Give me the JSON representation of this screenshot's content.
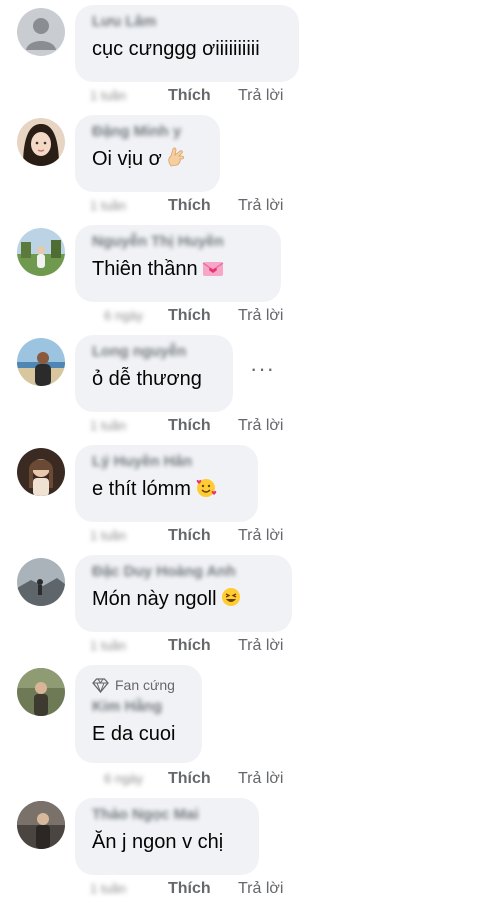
{
  "comments": [
    {
      "author": "Lưu Lâm",
      "text": "cục cưnggg ơiiiiiiiiii",
      "emoji": "",
      "time": "1 tuần",
      "like": "Thích",
      "reply": "Trả lời"
    },
    {
      "author": "Đặng Minh y",
      "text": "Oi vịu ơ",
      "emoji": "hand-emoji",
      "time": "1 tuần",
      "like": "Thích",
      "reply": "Trả lời"
    },
    {
      "author": "Nguyễn Thị Huyền",
      "text": "Thiên thầnn",
      "emoji": "love-letter-emoji",
      "time": "6 ngày",
      "like": "Thích",
      "reply": "Trả lời"
    },
    {
      "author": "Long nguyễn",
      "text": "ỏ dễ thương",
      "emoji": "",
      "time": "1 tuần",
      "like": "Thích",
      "reply": "Trả lời",
      "more": "···"
    },
    {
      "author": "Lý Huyền Hân",
      "text": "e thít lómm",
      "emoji": "smiling-hearts-emoji",
      "time": "1 tuần",
      "like": "Thích",
      "reply": "Trả lời"
    },
    {
      "author": "Đặc Duy Hoàng Anh",
      "text": "Món này ngoll",
      "emoji": "grinning-squint-emoji",
      "time": "1 tuần",
      "like": "Thích",
      "reply": "Trả lời"
    },
    {
      "author": "Kim Hằng",
      "text": "E da cuoi",
      "emoji": "",
      "badge": "Fan cứng",
      "time": "6 ngày",
      "like": "Thích",
      "reply": "Trả lời"
    },
    {
      "author": "Thảo Ngọc Mai",
      "text": "Ăn j ngon v chị",
      "emoji": "",
      "time": "1 tuần",
      "like": "Thích",
      "reply": "Trả lời"
    }
  ],
  "colors": {
    "bubble": "#f0f2f5",
    "secondary_text": "#65676b",
    "primary_text": "#050505"
  }
}
